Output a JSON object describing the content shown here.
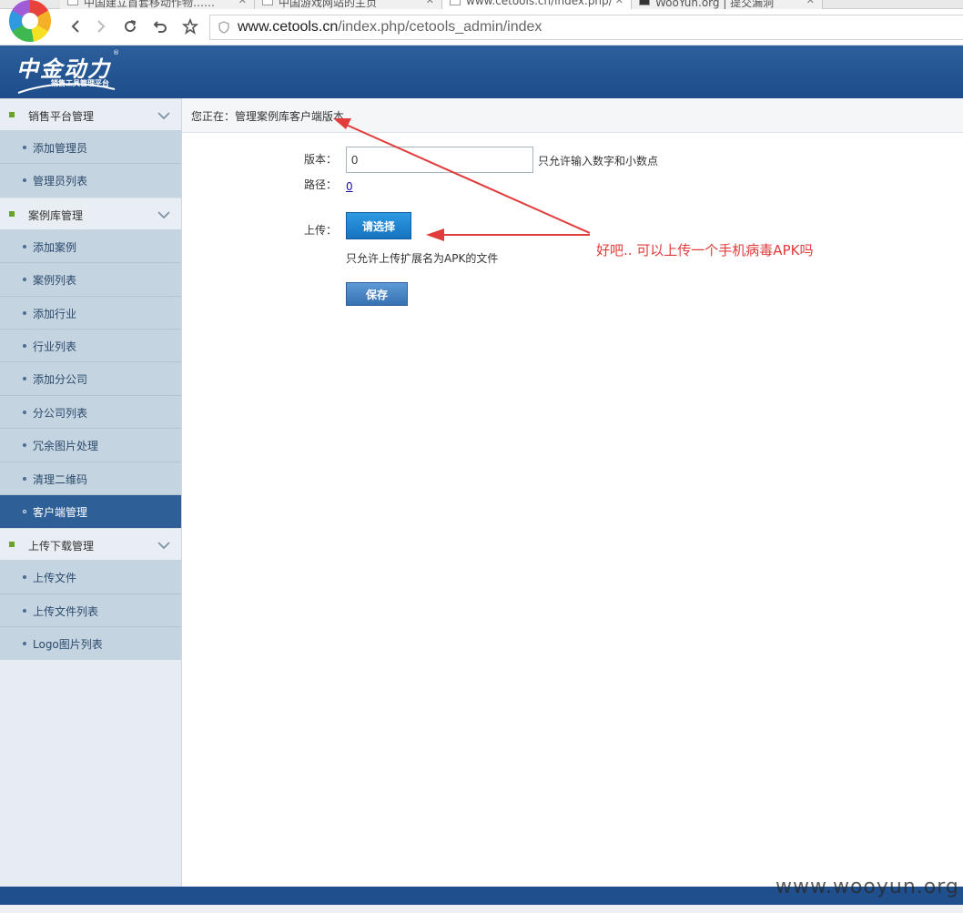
{
  "browser": {
    "tabs": [
      {
        "title": "中国建立首套移动作物……"
      },
      {
        "title": "中国游戏网站的主页"
      },
      {
        "title": "www.cetools.cn/index.php/"
      },
      {
        "title": "WooYun.org | 提交漏洞"
      }
    ],
    "url_host": "www.cetools.cn",
    "url_path": "/index.php/cetools_admin/index"
  },
  "brand": {
    "script": "中金动力",
    "subtitle": "销售工具管理平台",
    "reg": "®"
  },
  "sidebar": {
    "groups": [
      {
        "label": "销售平台管理",
        "items": [
          {
            "label": "添加管理员"
          },
          {
            "label": "管理员列表"
          }
        ]
      },
      {
        "label": "案例库管理",
        "items": [
          {
            "label": "添加案例"
          },
          {
            "label": "案例列表"
          },
          {
            "label": "添加行业"
          },
          {
            "label": "行业列表"
          },
          {
            "label": "添加分公司"
          },
          {
            "label": "分公司列表"
          },
          {
            "label": "冗余图片处理"
          },
          {
            "label": "清理二维码"
          },
          {
            "label": "客户端管理"
          }
        ]
      },
      {
        "label": "上传下载管理",
        "items": [
          {
            "label": "上传文件"
          },
          {
            "label": "上传文件列表"
          },
          {
            "label": "Logo图片列表"
          }
        ]
      }
    ]
  },
  "main": {
    "breadcrumb": "您正在：管理案例库客户端版本",
    "version_label": "版本：",
    "version_value": "0",
    "version_hint": "只允许输入数字和小数点",
    "path_label": "路径：",
    "path_value": "0",
    "upload_label": "上传：",
    "choose_button": "请选择",
    "upload_hint": "只允许上传扩展名为APK的文件",
    "save_button": "保存"
  },
  "annotation": {
    "text": "好吧.. 可以上传一个手机病毒APK吗",
    "color": "#e23b3b"
  },
  "watermark": "www.wooyun.org",
  "colors": {
    "header": "#1d4d8a",
    "sidebar_active": "#2f5f97",
    "group_marker": "#6aa32b"
  }
}
